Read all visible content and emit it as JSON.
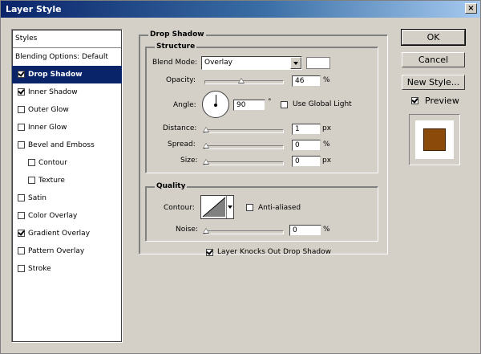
{
  "window": {
    "title": "Layer Style",
    "close_label": "×"
  },
  "styles": {
    "header": "Styles",
    "items": [
      {
        "label": "Blending Options: Default",
        "checkbox": false,
        "checked": false,
        "selected": false
      },
      {
        "label": "Drop Shadow",
        "checkbox": true,
        "checked": true,
        "selected": true
      },
      {
        "label": "Inner Shadow",
        "checkbox": true,
        "checked": true,
        "selected": false
      },
      {
        "label": "Outer Glow",
        "checkbox": true,
        "checked": false,
        "selected": false
      },
      {
        "label": "Inner Glow",
        "checkbox": true,
        "checked": false,
        "selected": false
      },
      {
        "label": "Bevel and Emboss",
        "checkbox": true,
        "checked": false,
        "selected": false
      },
      {
        "label": "Contour",
        "checkbox": true,
        "checked": false,
        "selected": false,
        "indent": true
      },
      {
        "label": "Texture",
        "checkbox": true,
        "checked": false,
        "selected": false,
        "indent": true
      },
      {
        "label": "Satin",
        "checkbox": true,
        "checked": false,
        "selected": false
      },
      {
        "label": "Color Overlay",
        "checkbox": true,
        "checked": false,
        "selected": false
      },
      {
        "label": "Gradient Overlay",
        "checkbox": true,
        "checked": true,
        "selected": false
      },
      {
        "label": "Pattern Overlay",
        "checkbox": true,
        "checked": false,
        "selected": false
      },
      {
        "label": "Stroke",
        "checkbox": true,
        "checked": false,
        "selected": false
      }
    ]
  },
  "drop_shadow": {
    "title": "Drop Shadow",
    "structure": {
      "title": "Structure",
      "blend_mode_label": "Blend Mode:",
      "blend_mode_value": "Overlay",
      "shadow_color": "#ffffff",
      "opacity_label": "Opacity:",
      "opacity_value": "46",
      "opacity_unit": "%",
      "opacity_fraction": 0.46,
      "angle_label": "Angle:",
      "angle_value": "90",
      "angle_unit": "°",
      "use_global_light_label": "Use Global Light",
      "use_global_light": false,
      "distance_label": "Distance:",
      "distance_value": "1",
      "distance_unit": "px",
      "spread_label": "Spread:",
      "spread_value": "0",
      "spread_unit": "%",
      "size_label": "Size:",
      "size_value": "0",
      "size_unit": "px"
    },
    "quality": {
      "title": "Quality",
      "contour_label": "Contour:",
      "anti_aliased_label": "Anti-aliased",
      "anti_aliased": false,
      "noise_label": "Noise:",
      "noise_value": "0",
      "noise_unit": "%"
    },
    "knockout_label": "Layer Knocks Out Drop Shadow",
    "knockout": true
  },
  "buttons": {
    "ok": "OK",
    "cancel": "Cancel",
    "new_style": "New Style..."
  },
  "preview": {
    "label": "Preview",
    "checked": true,
    "swatch_color": "#8b4a0a"
  },
  "colors": {
    "selection": "#0a246a",
    "dialog_bg": "#d4d0c8"
  }
}
